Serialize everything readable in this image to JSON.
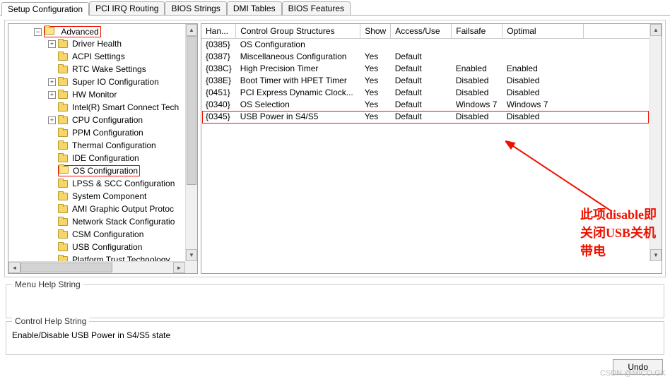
{
  "tabs": [
    "Setup Configuration",
    "PCI IRQ Routing",
    "BIOS Strings",
    "DMI Tables",
    "BIOS Features"
  ],
  "active_tab": 0,
  "tree": {
    "root": "Advanced",
    "items": [
      {
        "label": "Driver Health",
        "exp": "+"
      },
      {
        "label": "ACPI Settings",
        "exp": ""
      },
      {
        "label": "RTC Wake Settings",
        "exp": ""
      },
      {
        "label": "Super IO Configuration",
        "exp": "+"
      },
      {
        "label": "HW Monitor",
        "exp": "+"
      },
      {
        "label": "Intel(R) Smart Connect Tech",
        "exp": ""
      },
      {
        "label": "CPU Configuration",
        "exp": "+"
      },
      {
        "label": "PPM Configuration",
        "exp": ""
      },
      {
        "label": "Thermal Configuration",
        "exp": ""
      },
      {
        "label": "IDE Configuration",
        "exp": ""
      },
      {
        "label": "OS Configuration",
        "exp": "",
        "sel": true
      },
      {
        "label": "LPSS & SCC Configuration",
        "exp": ""
      },
      {
        "label": "System Component",
        "exp": ""
      },
      {
        "label": "AMI Graphic Output Protoc",
        "exp": ""
      },
      {
        "label": "Network Stack Configuratio",
        "exp": ""
      },
      {
        "label": "CSM Configuration",
        "exp": ""
      },
      {
        "label": "USB Configuration",
        "exp": ""
      },
      {
        "label": "Platform Trust Technology",
        "exp": ""
      }
    ]
  },
  "grid": {
    "cols": [
      "Han...",
      "Control Group Structures",
      "Show",
      "Access/Use",
      "Failsafe",
      "Optimal"
    ],
    "rows": [
      {
        "han": "{0385}",
        "ctl": "OS Configuration",
        "show": "",
        "acc": "",
        "fs": "",
        "opt": ""
      },
      {
        "han": "{0387}",
        "ctl": "Miscellaneous Configuration",
        "show": "Yes",
        "acc": "Default",
        "fs": "",
        "opt": ""
      },
      {
        "han": "{038C}",
        "ctl": "High Precision Timer",
        "show": "Yes",
        "acc": "Default",
        "fs": "Enabled",
        "opt": "Enabled"
      },
      {
        "han": "{038E}",
        "ctl": "Boot Timer with HPET Timer",
        "show": "Yes",
        "acc": "Default",
        "fs": "Disabled",
        "opt": "Disabled"
      },
      {
        "han": "{0451}",
        "ctl": "PCI Express Dynamic Clock...",
        "show": "Yes",
        "acc": "Default",
        "fs": "Disabled",
        "opt": "Disabled"
      },
      {
        "han": "{0340}",
        "ctl": "OS Selection",
        "show": "Yes",
        "acc": "Default",
        "fs": "Windows 7",
        "opt": "Windows 7"
      },
      {
        "han": "{0345}",
        "ctl": "USB Power in S4/S5",
        "show": "Yes",
        "acc": "Default",
        "fs": "Disabled",
        "opt": "Disabled",
        "hl": true
      }
    ]
  },
  "annotation": "此项disable即关闭USB关机带电",
  "help": {
    "menu_legend": "Menu Help String",
    "menu_text": "",
    "control_legend": "Control Help String",
    "control_text": "Enable/Disable USB Power in S4/S5 state"
  },
  "buttons": {
    "undo": "Undo"
  },
  "watermark": "CSDN @MICO.GK"
}
